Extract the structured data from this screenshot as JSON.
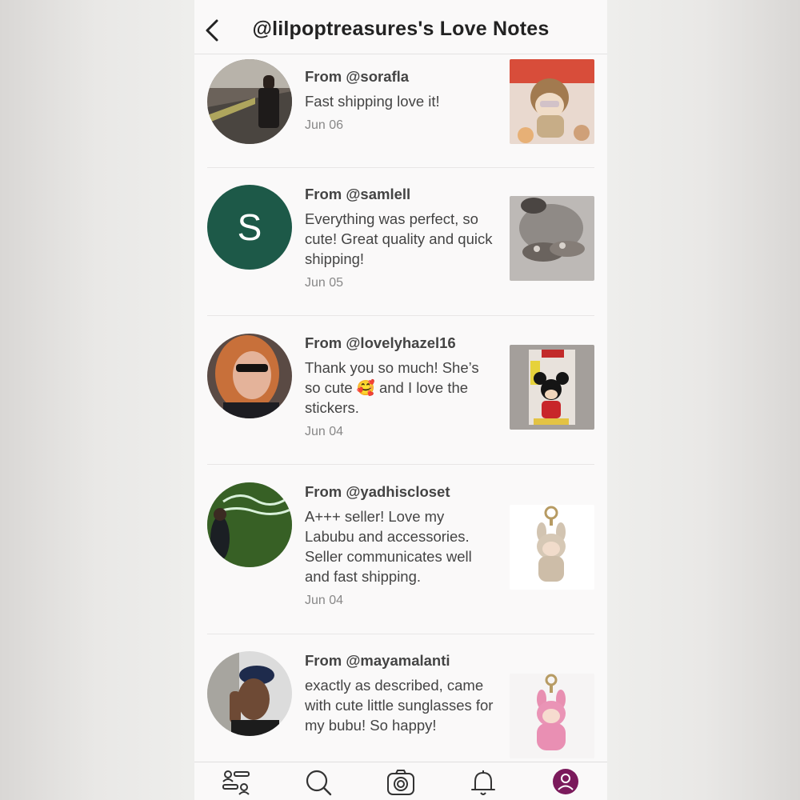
{
  "header": {
    "title": "@lilpoptreasures's Love Notes"
  },
  "notes": [
    {
      "from": "From @sorafla",
      "message": "Fast shipping love it!",
      "date": "Jun 06",
      "avatar_letter": ""
    },
    {
      "from": "From @samlell",
      "message": "Everything was perfect, so cute! Great quality and quick shipping!",
      "date": "Jun 05",
      "avatar_letter": "S"
    },
    {
      "from": "From @lovelyhazel16",
      "message": "Thank you so much! She’s so cute 🥰 and I love the stickers.",
      "date": "Jun 04",
      "avatar_letter": ""
    },
    {
      "from": "From @yadhiscloset",
      "message": "A+++ seller! Love my Labubu and accessories. Seller communicates well and fast shipping.",
      "date": "Jun 04",
      "avatar_letter": ""
    },
    {
      "from": "From @mayamalanti",
      "message": "exactly as described, came with cute little sunglasses for my bubu! So happy!",
      "date": "",
      "avatar_letter": ""
    }
  ],
  "tabbar": {
    "tabs": [
      {
        "icon": "feed-icon",
        "label": ""
      },
      {
        "icon": "search-icon",
        "label": ""
      },
      {
        "icon": "camera-icon",
        "label": ""
      },
      {
        "icon": "bell-icon",
        "label": ""
      },
      {
        "icon": "profile-icon",
        "label": ""
      }
    ]
  },
  "colors": {
    "accent": "#7b1a5c",
    "avatar_green": "#1d5948"
  }
}
